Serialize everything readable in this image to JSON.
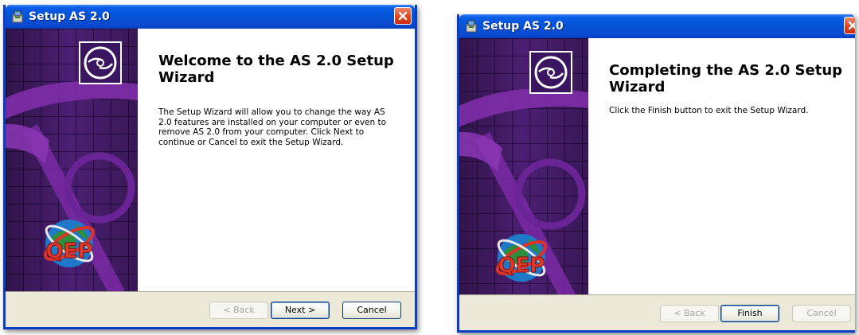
{
  "windows": [
    {
      "title": "Setup AS 2.0",
      "heading": "Welcome to the AS 2.0 Setup Wizard",
      "description": "The Setup Wizard will allow you to change the way AS 2.0 features are installed on your computer or even to remove AS 2.0 from your computer.  Click Next to continue or Cancel to exit the Setup Wizard.",
      "buttons": {
        "back": "< Back",
        "next": "Next >",
        "cancel": "Cancel"
      },
      "logo_text": "QEP"
    },
    {
      "title": "Setup AS 2.0",
      "heading": "Completing the AS 2.0 Setup Wizard",
      "description": "Click the Finish button to exit the Setup Wizard.",
      "buttons": {
        "back": "< Back",
        "finish": "Finish",
        "cancel": "Cancel"
      },
      "logo_text": "QEP"
    }
  ],
  "colors": {
    "titlebar": "#0453d6",
    "side_panel": "#4a1d70",
    "close_button": "#e0451f",
    "frame": "#ece9d8"
  },
  "icons": [
    "installer-icon",
    "close-icon",
    "cd-disc-icon",
    "qep-globe-logo"
  ]
}
